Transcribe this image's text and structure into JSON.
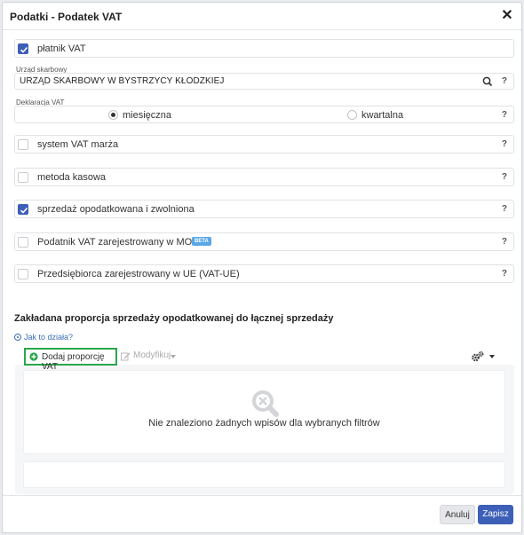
{
  "dialog": {
    "title": "Podatki - Podatek VAT"
  },
  "rows": {
    "platnik": {
      "label": "płatnik VAT",
      "checked": true
    },
    "system_marza": {
      "label": "system VAT marża",
      "checked": false
    },
    "metoda_kasowa": {
      "label": "metoda kasowa",
      "checked": false
    },
    "sprzedaz": {
      "label": "sprzedaż opodatkowana i zwolniona",
      "checked": true
    },
    "moss": {
      "label": "Podatnik VAT zarejestrowany w MOSS",
      "badge": "BETA",
      "checked": false
    },
    "vat_ue": {
      "label": "Przedsiębiorca zarejestrowany w UE (VAT-UE)",
      "checked": false
    }
  },
  "help_mark": "?",
  "tax_office": {
    "label": "Urząd skarbowy",
    "value": "URZĄD SKARBOWY W BYSTRZYCY KŁODZKIEJ"
  },
  "declaration": {
    "label": "Deklaracja VAT",
    "options": [
      "miesięczna",
      "kwartalna"
    ],
    "selected": "miesięczna"
  },
  "proportion": {
    "title": "Zakładana proporcja sprzedaży opodatkowanej do łącznej sprzedaży",
    "howto": "Jak to działa?",
    "add_label": "Dodaj proporcję VAT",
    "modify_label": "Modyfikuj",
    "empty_text": "Nie znaleziono żadnych wpisów dla wybranych filtrów"
  },
  "footer": {
    "cancel": "Anuluj",
    "save": "Zapisz"
  },
  "colors": {
    "accent": "#3c5fb8",
    "add_border": "#2aa64b",
    "badge": "#5aa7e6"
  }
}
